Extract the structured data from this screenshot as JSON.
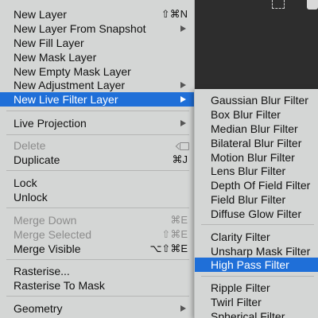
{
  "main_menu": {
    "new_layer": "New Layer",
    "new_layer_shortcut": "⇧⌘N",
    "new_layer_from_snapshot": "New Layer From Snapshot",
    "new_fill_layer": "New Fill Layer",
    "new_mask_layer": "New Mask Layer",
    "new_empty_mask_layer": "New Empty Mask Layer",
    "new_adjustment_layer": "New Adjustment Layer",
    "new_live_filter_layer": "New Live Filter Layer",
    "live_projection": "Live Projection",
    "delete": "Delete",
    "duplicate": "Duplicate",
    "duplicate_shortcut": "⌘J",
    "lock": "Lock",
    "unlock": "Unlock",
    "merge_down": "Merge Down",
    "merge_down_shortcut": "⌘E",
    "merge_selected": "Merge Selected",
    "merge_selected_shortcut": "⇧⌘E",
    "merge_visible": "Merge Visible",
    "merge_visible_shortcut": "⌥⇧⌘E",
    "rasterise": "Rasterise...",
    "rasterise_to_mask": "Rasterise To Mask",
    "geometry": "Geometry"
  },
  "submenu": {
    "gaussian_blur": "Gaussian Blur Filter",
    "box_blur": "Box Blur Filter",
    "median_blur": "Median Blur Filter",
    "bilateral_blur": "Bilateral Blur Filter",
    "motion_blur": "Motion Blur Filter",
    "lens_blur": "Lens Blur Filter",
    "depth_of_field": "Depth Of Field Filter",
    "field_blur": "Field Blur Filter",
    "diffuse_glow": "Diffuse Glow Filter",
    "clarity": "Clarity Filter",
    "unsharp_mask": "Unsharp Mask Filter",
    "high_pass": "High Pass Filter",
    "ripple": "Ripple Filter",
    "twirl": "Twirl Filter",
    "spherical": "Spherical Filter"
  },
  "colors": {
    "menu_bg": "#d4d6d5",
    "highlight": "#1f6fd8",
    "disabled_text": "#8c8c8c"
  }
}
